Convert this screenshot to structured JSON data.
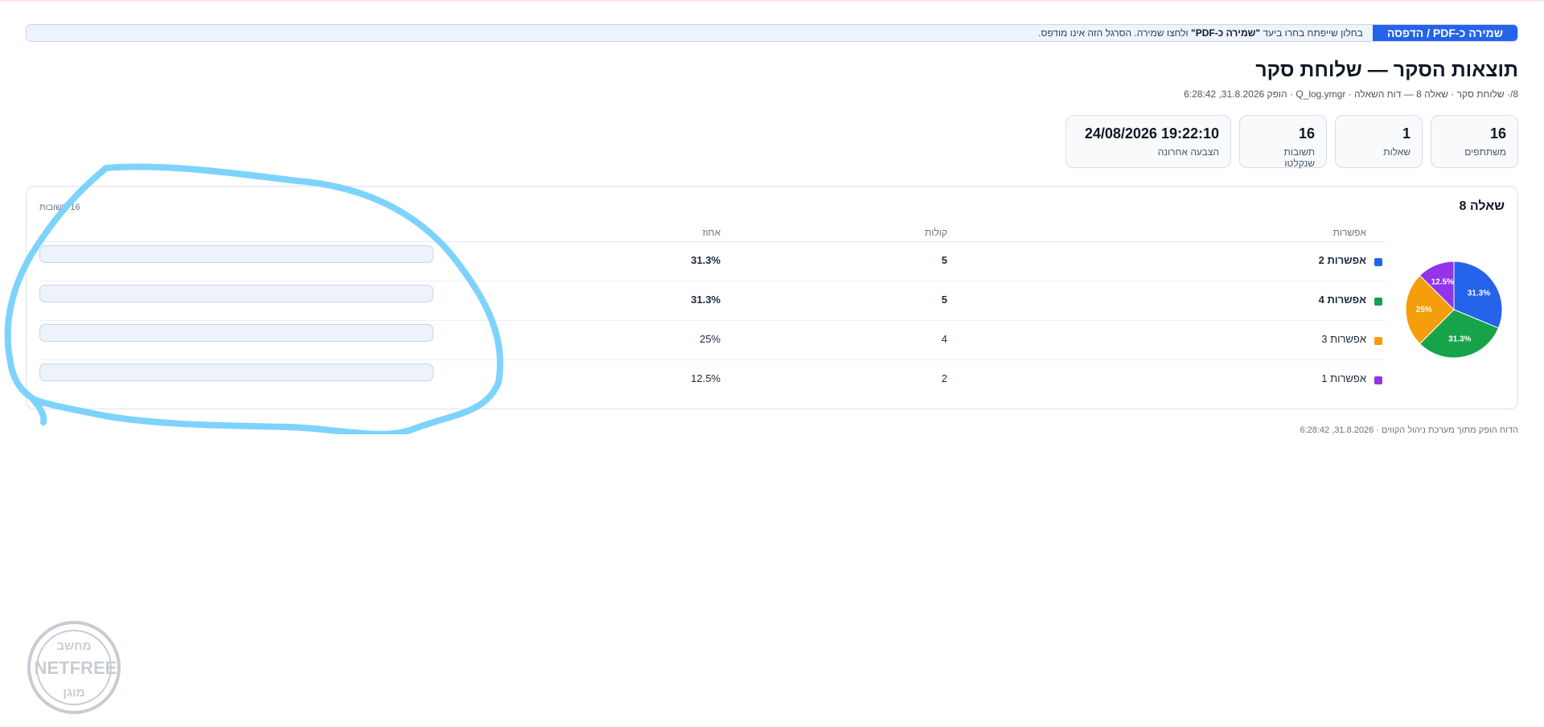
{
  "print_bar": {
    "button_label": "שמירה כ-PDF / הדפסה",
    "note_before": "בחלון שייפתח בחרו ביעד ",
    "note_bold": "\"שמירה כ-PDF\"",
    "note_after": " ולחצו שמירה. הסרגל הזה אינו מודפס."
  },
  "header": {
    "title": "תוצאות הסקר — שלוחת סקר",
    "meta": "8/· שלוחת סקר · שאלה 8 — דוח השאלה · Q_log.ymgr · הופק 31.8.2026, 6:28:42"
  },
  "kpis": [
    {
      "value": "16",
      "label": "משתתפים"
    },
    {
      "value": "1",
      "label": "שאלות"
    },
    {
      "value": "16",
      "label": "תשובות שנקלטו"
    },
    {
      "value": "19:22:10 24/08/2026",
      "label": "הצבעה אחרונה"
    }
  ],
  "question": {
    "title": "שאלה 8",
    "answers_count": "16 תשובות",
    "columns": {
      "option": "אפשרות",
      "votes": "קולות",
      "percent": "אחוז"
    },
    "rows": [
      {
        "label": "אפשרות 2",
        "votes": "5",
        "percent": "31.3%",
        "fraction": 0.313,
        "color": "#2563eb",
        "bold": true
      },
      {
        "label": "אפשרות 4",
        "votes": "5",
        "percent": "31.3%",
        "fraction": 0.313,
        "color": "#16a34a",
        "bold": true
      },
      {
        "label": "אפשרות 3",
        "votes": "4",
        "percent": "25%",
        "fraction": 0.25,
        "color": "#f59e0b",
        "bold": false
      },
      {
        "label": "אפשרות 1",
        "votes": "2",
        "percent": "12.5%",
        "fraction": 0.125,
        "color": "#9333ea",
        "bold": false
      }
    ]
  },
  "chart_data": {
    "type": "pie",
    "categories": [
      "אפשרות 2",
      "אפשרות 4",
      "אפשרות 3",
      "אפשרות 1"
    ],
    "values": [
      5,
      5,
      4,
      2
    ],
    "slice_labels": [
      "31.3%",
      "31.3%",
      "25%",
      "12.5%"
    ],
    "colors": [
      "#2563eb",
      "#16a34a",
      "#f59e0b",
      "#9333ea"
    ]
  },
  "footer": {
    "text": "הדוח הופק מתוך מערכת ניהול הקווים · 31.8.2026, 6:28:42"
  },
  "watermark": {
    "top": "מחשב",
    "middle": "NETFREE",
    "bottom": "מוגן"
  }
}
